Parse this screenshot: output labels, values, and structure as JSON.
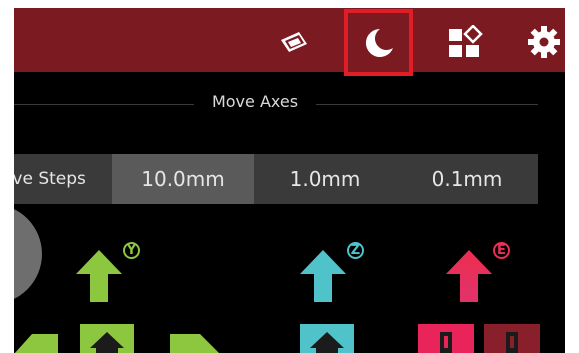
{
  "header": {
    "icons": [
      "fullscreen-map-icon",
      "moon-icon",
      "widgets-icon",
      "gear-icon"
    ],
    "colors": {
      "bar": "#7b1a20",
      "highlight": "#e11d26"
    }
  },
  "section": {
    "title": "Move Axes"
  },
  "steps": {
    "label": "ove Steps",
    "options": [
      "10.0mm",
      "1.0mm",
      "0.1mm"
    ],
    "selected": "10.0mm"
  },
  "axes": {
    "xy": {
      "badge": "Y",
      "color": "#8dc63f"
    },
    "z": {
      "badge": "Z",
      "color": "#4fc3c9"
    },
    "e": {
      "badge": "E",
      "color": "#ec2f55"
    }
  }
}
